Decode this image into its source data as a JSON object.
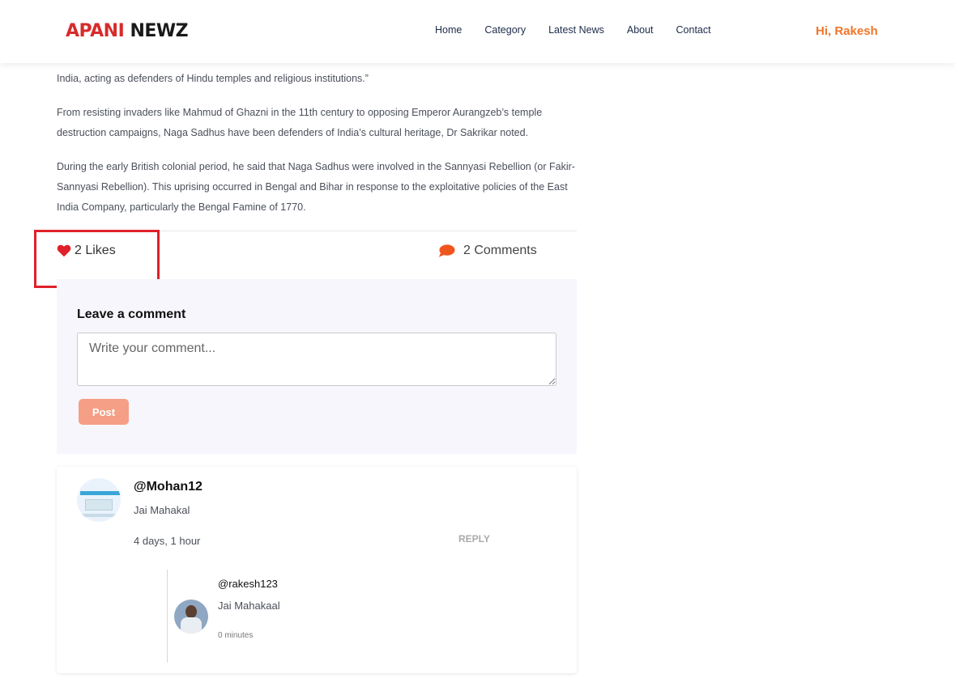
{
  "header": {
    "logo_part1": "APANI",
    "logo_part2": "NEWZ",
    "nav": [
      "Home",
      "Category",
      "Latest News",
      "About",
      "Contact"
    ],
    "greeting": "Hi, Rakesh"
  },
  "article": {
    "paragraphs": [
      "India, acting as defenders of Hindu temples and religious institutions.”",
      "From resisting invaders like Mahmud of Ghazni in the 11th century to opposing Emperor Aurangzeb’s temple destruction campaigns, Naga Sadhus have been defenders of India’s cultural heritage, Dr Sakrikar noted.",
      "During the early British colonial period, he said that Naga Sadhus were involved in the Sannyasi Rebellion (or Fakir-Sannyasi Rebellion). This uprising occurred in Bengal and Bihar in response to the exploitative policies of the East India Company, particularly the Bengal Famine of 1770."
    ]
  },
  "engagement": {
    "likes_label": "2 Likes",
    "comments_label": "2 Comments"
  },
  "comment_form": {
    "title": "Leave a comment",
    "placeholder": "Write your comment...",
    "post_label": "Post"
  },
  "comments": [
    {
      "user": "@Mohan12",
      "text": "Jai Mahakal",
      "time": "4 days, 1 hour",
      "reply_label": "REPLY",
      "replies": [
        {
          "user": "@rakesh123",
          "text": "Jai Mahakaal",
          "time": "0 minutes"
        }
      ]
    }
  ],
  "colors": {
    "accent": "#f0762a",
    "heart": "#e0202a",
    "comment_icon": "#f0551e",
    "post_button": "#f59f86",
    "form_bg": "#f8f6fd"
  }
}
